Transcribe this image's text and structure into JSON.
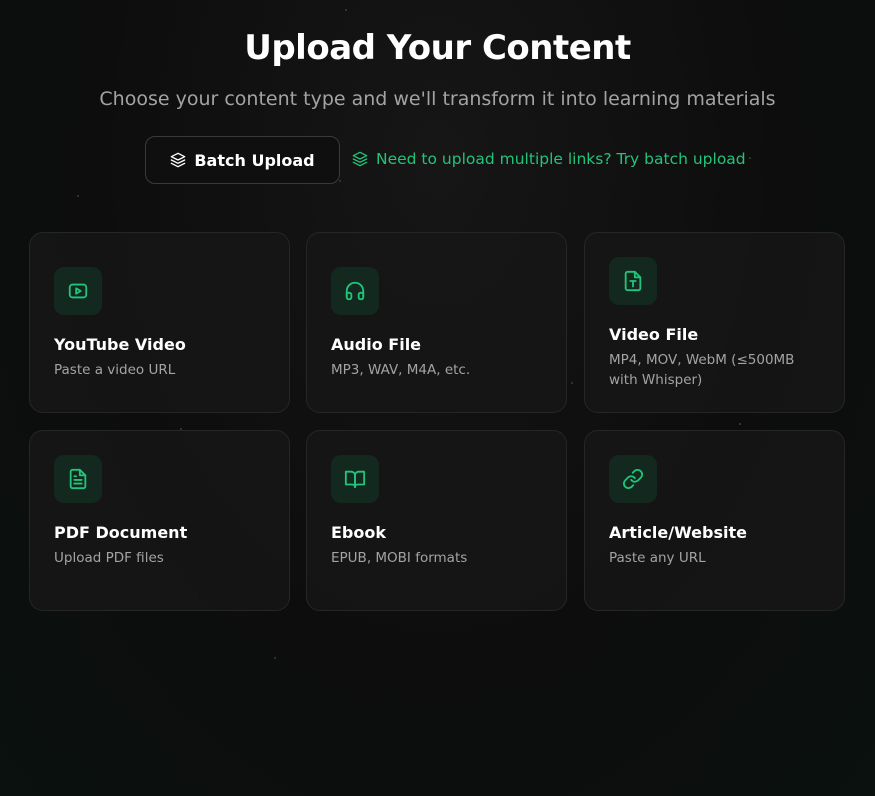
{
  "header": {
    "title": "Upload Your Content",
    "subtitle": "Choose your content type and we'll transform it into learning materials"
  },
  "batch": {
    "button_label": "Batch Upload",
    "button_icon": "layers-icon",
    "hint_text": "Need to upload multiple links? Try batch upload",
    "hint_icon": "layers-icon"
  },
  "colors": {
    "accent": "#22c37a",
    "background": "#0d0d0d",
    "card_background": "#161616",
    "icon_box": "#13281f"
  },
  "content_types": [
    {
      "title": "YouTube Video",
      "description": "Paste a video URL",
      "icon": "play-icon"
    },
    {
      "title": "Audio File",
      "description": "MP3, WAV, M4A, etc.",
      "icon": "headphones-icon"
    },
    {
      "title": "Video File",
      "description": "MP4, MOV, WebM (≤500MB with Whisper)",
      "icon": "text-file-icon"
    },
    {
      "title": "PDF Document",
      "description": "Upload PDF files",
      "icon": "document-icon"
    },
    {
      "title": "Ebook",
      "description": "EPUB, MOBI formats",
      "icon": "book-icon"
    },
    {
      "title": "Article/Website",
      "description": "Paste any URL",
      "icon": "link-icon"
    }
  ]
}
